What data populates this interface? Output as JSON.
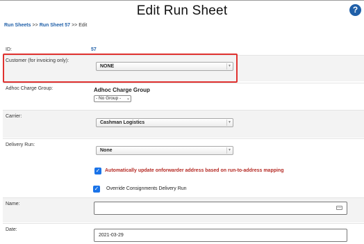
{
  "page": {
    "title": "Edit Run Sheet",
    "help_symbol": "?"
  },
  "breadcrumb": {
    "items": [
      "Run Sheets",
      "Run Sheet 57",
      "Edit"
    ],
    "separator": ">>"
  },
  "form": {
    "id": {
      "label": "ID:",
      "value": "57"
    },
    "customer": {
      "label": "Customer (for invoicing only):",
      "selected": "NONE"
    },
    "adhoc": {
      "label": "Adhoc Charge Group:",
      "heading": "Adhoc Charge Group",
      "selected": "- No Group -"
    },
    "carrier": {
      "label": "Carrier:",
      "selected": "Cashman Logistics"
    },
    "delivery_run": {
      "label": "Delivery Run:",
      "selected": "None"
    },
    "auto_update": {
      "label": "Automatically update onforwarder address based on run-to-address mapping",
      "checked": true
    },
    "override": {
      "label": "Override Consignments Delivery Run",
      "checked": true
    },
    "name": {
      "label": "Name:",
      "value": ""
    },
    "date": {
      "label": "Date:",
      "value": "2021-03-29"
    }
  },
  "colors": {
    "link": "#1f5fa8",
    "highlight": "#e0312f",
    "warning_text": "#b52a24",
    "checkbox": "#1a73e8"
  },
  "icons": {
    "help": "help-icon",
    "dropdown": "chevron-down-icon",
    "checkbox": "checkmark-icon",
    "keyboard": "keyboard-icon"
  }
}
